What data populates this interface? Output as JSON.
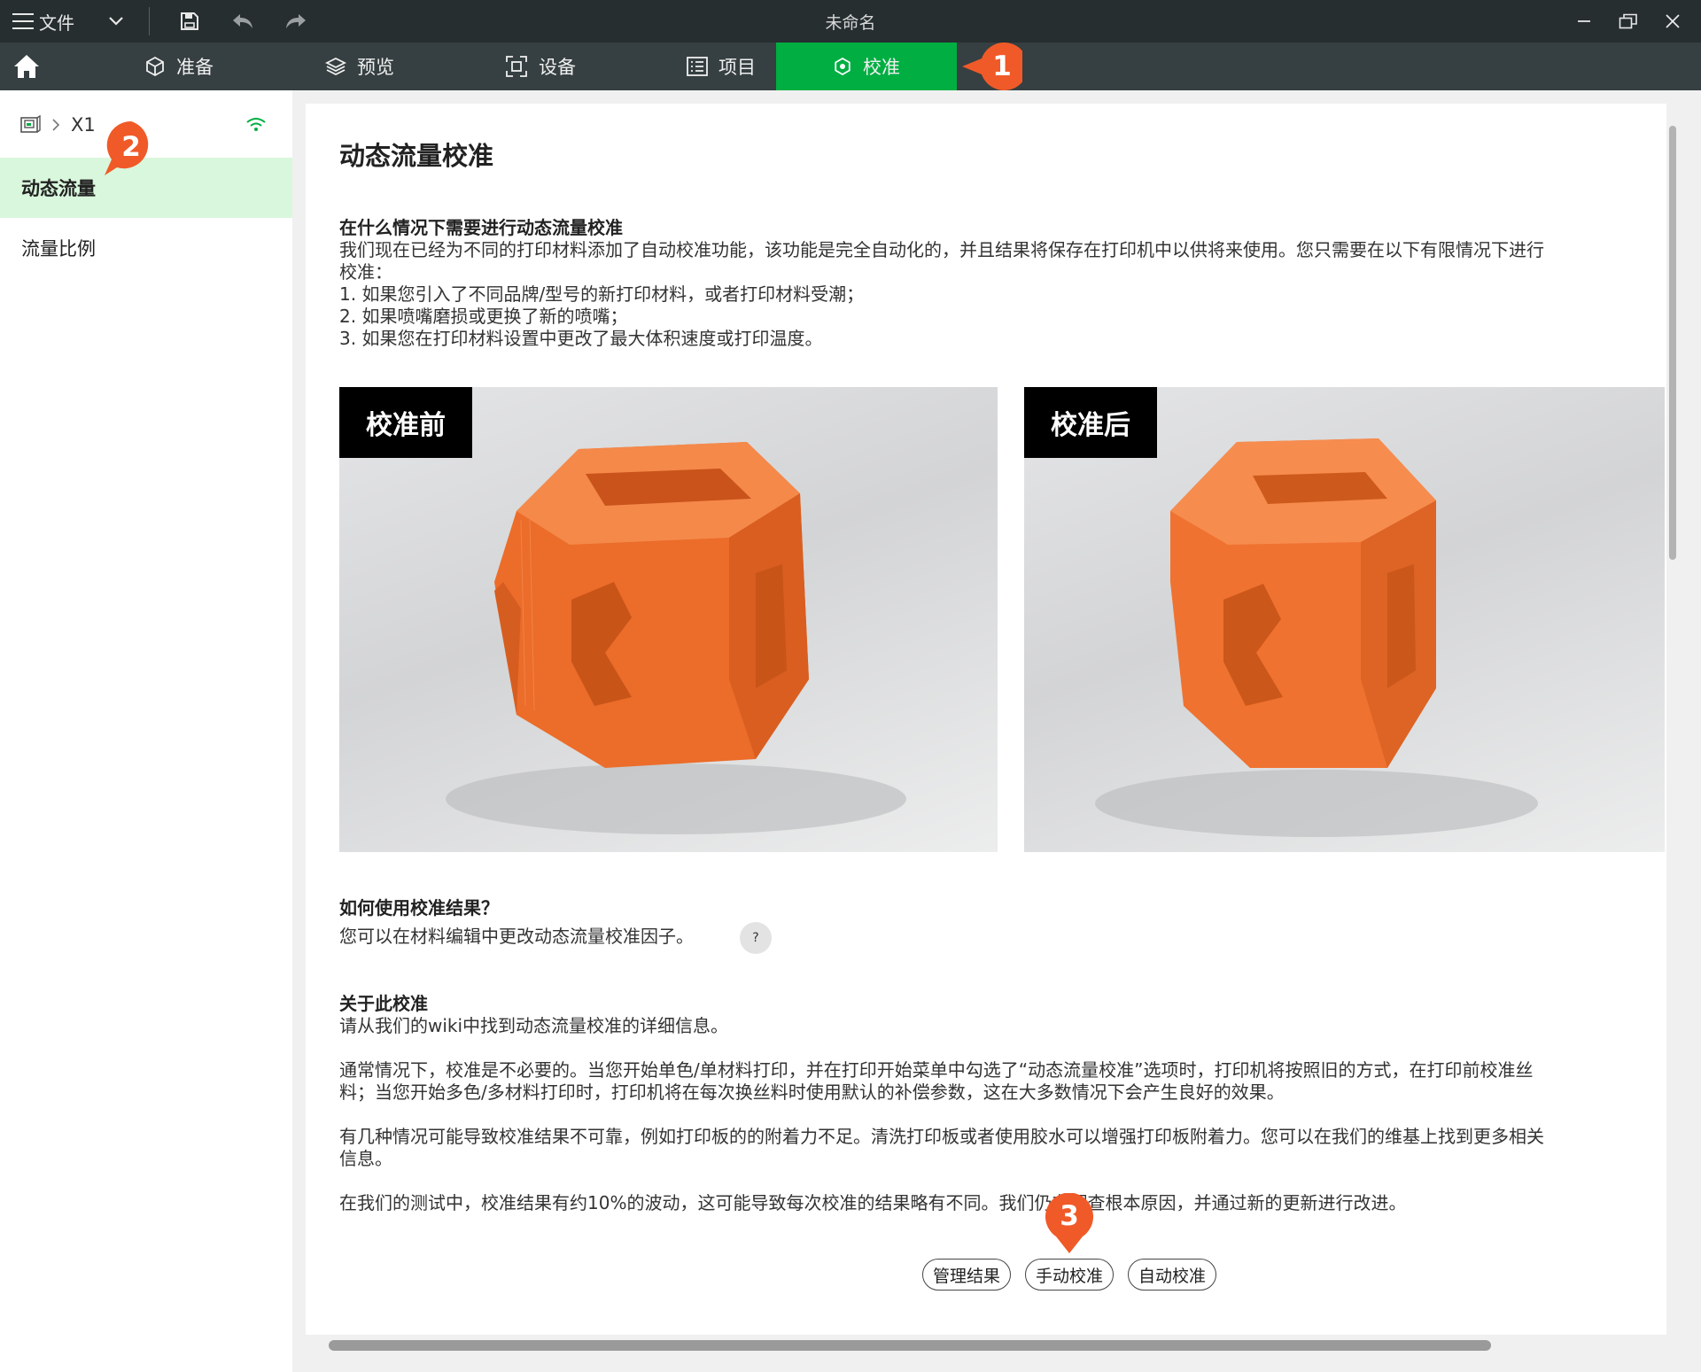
{
  "titlebar": {
    "menu_label": "文件",
    "window_title": "未命名"
  },
  "nav": {
    "tabs": [
      {
        "label": "准备",
        "icon": "cube-icon"
      },
      {
        "label": "预览",
        "icon": "layers-icon"
      },
      {
        "label": "设备",
        "icon": "device-icon"
      },
      {
        "label": "项目",
        "icon": "list-icon"
      },
      {
        "label": "校准",
        "icon": "calibration-icon",
        "active": true
      }
    ]
  },
  "markers": [
    "1",
    "2",
    "3"
  ],
  "sidebar": {
    "printer_name": "X1",
    "items": [
      {
        "label": "动态流量",
        "active": true
      },
      {
        "label": "流量比例",
        "active": false
      }
    ]
  },
  "main": {
    "title": "动态流量校准",
    "when_heading": "在什么情况下需要进行动态流量校准",
    "when_intro_1": "我们现在已经为不同的打印材料添加了自动校准功能，该功能是完全自动化的，并且结果将保存在打印机中以供将来使用。您只需要在以下有限情况下进行",
    "when_intro_2": "校准：",
    "when_cases": [
      "1. 如果您引入了不同品牌/型号的新打印材料，或者打印材料受潮；",
      "2. 如果喷嘴磨损或更换了新的喷嘴；",
      "3. 如果您在打印材料设置中更改了最大体积速度或打印温度。"
    ],
    "images": [
      {
        "label": "校准前"
      },
      {
        "label": "校准后"
      }
    ],
    "use_heading": "如何使用校准结果？",
    "use_text": "您可以在材料编辑中更改动态流量校准因子。",
    "help_label": "?",
    "about_heading": "关于此校准",
    "about_text": "请从我们的wiki中找到动态流量校准的详细信息。",
    "para1_line1": "通常情况下，校准是不必要的。当您开始单色/单材料打印，并在打印开始菜单中勾选了“动态流量校准”选项时，打印机将按照旧的方式，在打印前校准丝",
    "para1_line2": "料；当您开始多色/多材料打印时，打印机将在每次换丝料时使用默认的补偿参数，这在大多数情况下会产生良好的效果。",
    "para2_line1": "有几种情况可能导致校准结果不可靠，例如打印板的的附着力不足。清洗打印板或者使用胶水可以增强打印板附着力。您可以在我们的维基上找到更多相关",
    "para2_line2": "信息。",
    "para3": "在我们的测试中，校准结果有约10%的波动，这可能导致每次校准的结果略有不同。我们仍在调查根本原因，并通过新的更新进行改进。",
    "buttons": [
      "管理结果",
      "手动校准",
      "自动校准"
    ]
  },
  "colors": {
    "accent_green": "#00ae42",
    "titlebar_bg": "#262e30",
    "navbar_bg": "#363f41",
    "marker_orange": "#f05a28",
    "sidebar_active_bg": "#d9f7dc",
    "print_orange": "#f07532"
  }
}
